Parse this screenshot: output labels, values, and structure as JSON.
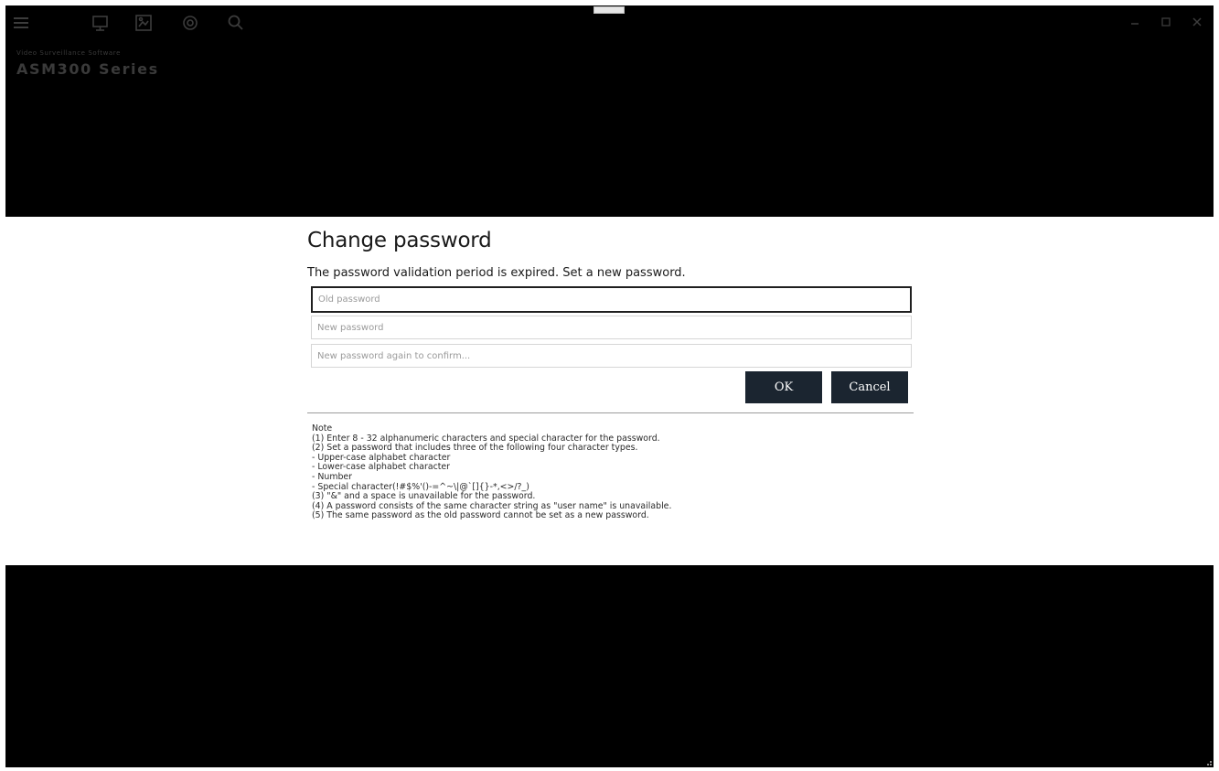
{
  "app": {
    "brand_subtitle": "Video Surveillance Software",
    "brand_title": "ASM300 Series"
  },
  "toolbar": {
    "icons": [
      "menu-icon",
      "monitor-icon",
      "image-icon",
      "gear-icon",
      "search-icon"
    ]
  },
  "window_controls": [
    "minimize-icon",
    "maximize-icon",
    "close-icon"
  ],
  "dialog": {
    "title": "Change password",
    "message": "The password validation period is expired. Set a new password.",
    "fields": {
      "old_password": {
        "placeholder": "Old password"
      },
      "new_password": {
        "placeholder": "New password"
      },
      "confirm_password": {
        "placeholder": "New password again to confirm..."
      }
    },
    "ok_label": "OK",
    "cancel_label": "Cancel"
  },
  "notes": {
    "heading": "Note",
    "lines": [
      "(1) Enter 8 - 32 alphanumeric characters and special character for the password.",
      "(2) Set a password that includes three of the following four character types.",
      "- Upper-case alphabet character",
      "- Lower-case alphabet character",
      "- Number",
      "- Special character(!#$%'()-=^~\\|@`[]{}-*,<>/?_)",
      "(3) \"&\" and a space is unavailable for the password.",
      "(4) A password consists of the same character string as \"user name\" is unavailable.",
      "(5) The same password as the old password cannot be set as a new password."
    ]
  },
  "colors": {
    "background_band": "#000000",
    "button_bg": "#1b2530",
    "button_text": "#ffffff",
    "focus_border": "#1f1f1f"
  }
}
